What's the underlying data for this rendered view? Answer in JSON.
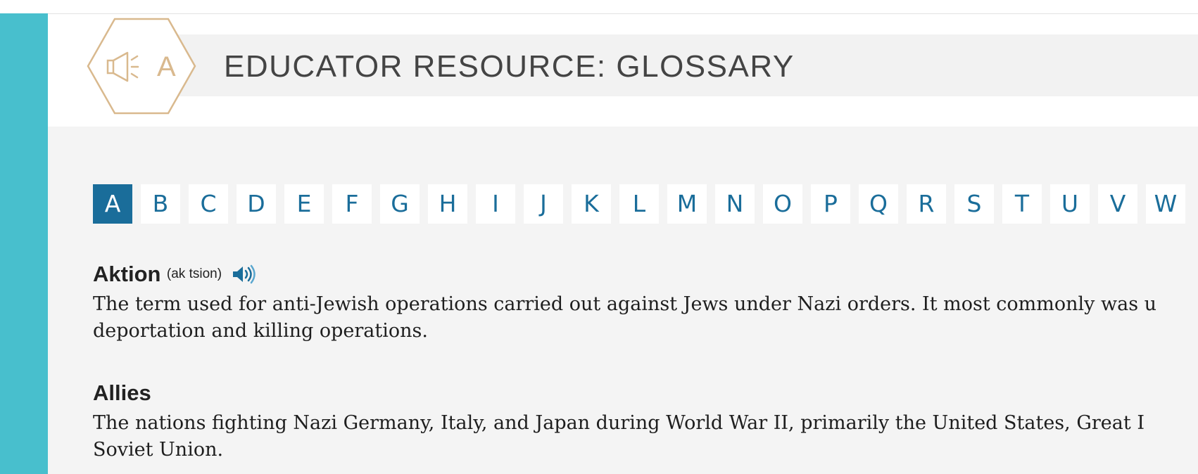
{
  "header": {
    "title": "EDUCATOR RESOURCE: GLOSSARY",
    "logo_icon": "megaphone-letter-a-hexagon-icon",
    "logo_text": "A",
    "accent_color": "#48bfcd",
    "logo_color": "#d9b98e"
  },
  "alphabet": {
    "active": "A",
    "active_color": "#1a6d9a",
    "letters": [
      "A",
      "B",
      "C",
      "D",
      "E",
      "F",
      "G",
      "H",
      "I",
      "J",
      "K",
      "L",
      "M",
      "N",
      "O",
      "P",
      "Q",
      "R",
      "S",
      "T",
      "U",
      "V",
      "W"
    ]
  },
  "entries": [
    {
      "term": "Aktion",
      "pronunciation": "(ak tsion)",
      "audio_icon": "speaker-icon",
      "definition": "The term used for anti-Jewish operations carried out against Jews under Nazi orders. It most commonly was u\ndeportation and killing operations."
    },
    {
      "term": "Allies",
      "definition": "The nations fighting Nazi Germany, Italy, and Japan during World War II, primarily the United States, Great I\nSoviet Union."
    }
  ]
}
